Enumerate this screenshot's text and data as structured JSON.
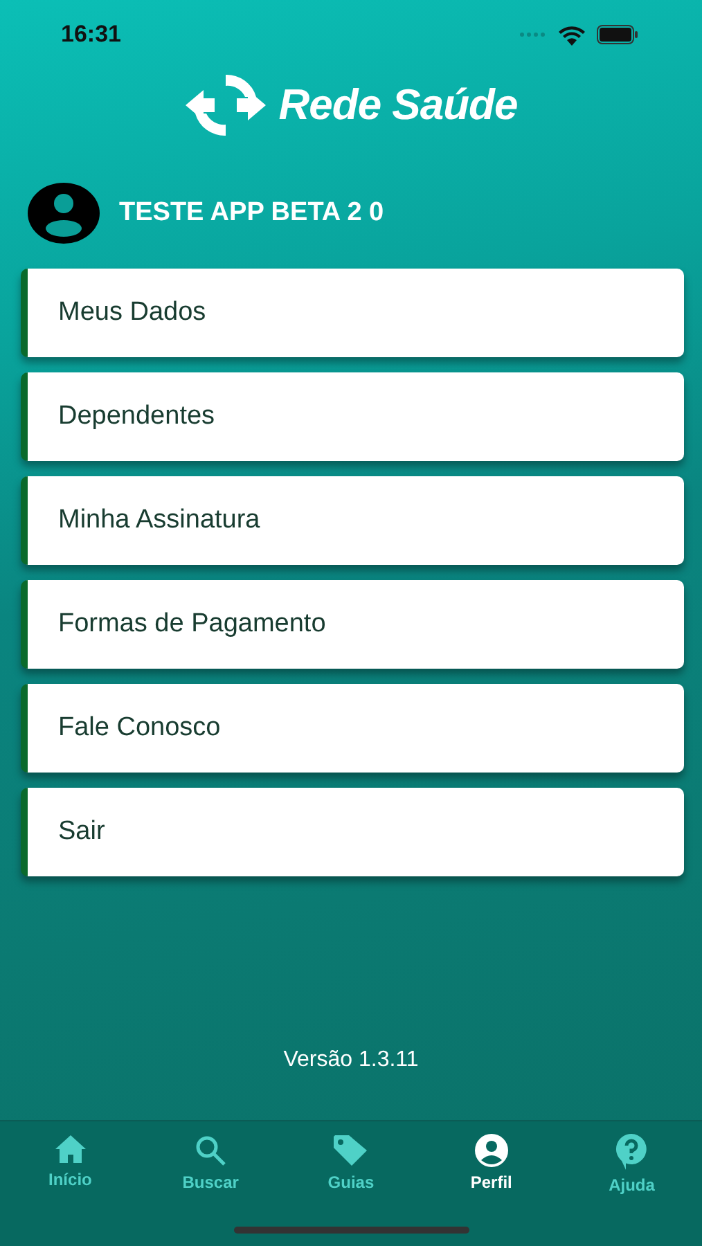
{
  "status_bar": {
    "time": "16:31"
  },
  "logo": {
    "text": "Rede Saúde"
  },
  "profile": {
    "name": "TESTE APP BETA 2 0"
  },
  "menu": [
    {
      "label": "Meus Dados"
    },
    {
      "label": "Dependentes"
    },
    {
      "label": "Minha Assinatura"
    },
    {
      "label": "Formas de Pagamento"
    },
    {
      "label": "Fale Conosco"
    },
    {
      "label": "Sair"
    }
  ],
  "version": "Versão 1.3.11",
  "tabs": [
    {
      "label": "Início",
      "kind": "home",
      "selected": false
    },
    {
      "label": "Buscar",
      "kind": "search",
      "selected": false
    },
    {
      "label": "Guias",
      "kind": "tag",
      "selected": false
    },
    {
      "label": "Perfil",
      "kind": "user",
      "selected": true
    },
    {
      "label": "Ajuda",
      "kind": "help",
      "selected": false
    }
  ]
}
